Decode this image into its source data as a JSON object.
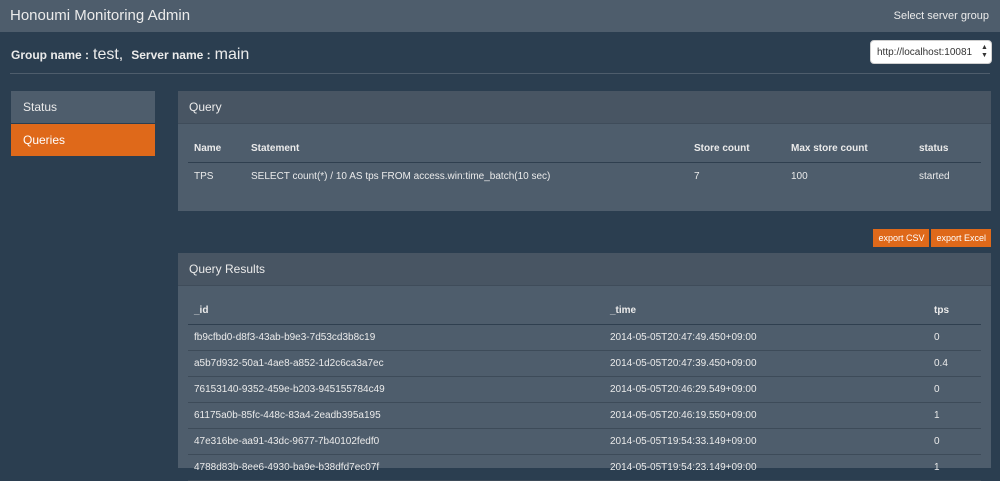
{
  "navbar": {
    "brand": "Honoumi Monitoring Admin",
    "right_link": "Select server group"
  },
  "header": {
    "group_label": "Group name :",
    "group_value": "test,",
    "server_label": "Server name :",
    "server_value": "main",
    "server_select": {
      "selected": "http://localhost:10081"
    }
  },
  "sidebar": {
    "items": [
      {
        "label": "Status"
      },
      {
        "label": "Queries"
      }
    ],
    "active_index": 1
  },
  "query_panel": {
    "title": "Query",
    "columns": [
      "Name",
      "Statement",
      "Store count",
      "Max store count",
      "status"
    ],
    "rows": [
      {
        "name": "TPS",
        "statement": "SELECT count(*) / 10 AS tps FROM access.win:time_batch(10 sec)",
        "store_count": "7",
        "max_store_count": "100",
        "status": "started"
      }
    ]
  },
  "buttons": {
    "export_csv": "export CSV",
    "export_excel": "export Excel"
  },
  "results_panel": {
    "title": "Query Results",
    "columns": [
      "_id",
      "_time",
      "tps"
    ],
    "rows": [
      {
        "id": "fb9cfbd0-d8f3-43ab-b9e3-7d53cd3b8c19",
        "time": "2014-05-05T20:47:49.450+09:00",
        "tps": "0"
      },
      {
        "id": "a5b7d932-50a1-4ae8-a852-1d2c6ca3a7ec",
        "time": "2014-05-05T20:47:39.450+09:00",
        "tps": "0.4"
      },
      {
        "id": "76153140-9352-459e-b203-945155784c49",
        "time": "2014-05-05T20:46:29.549+09:00",
        "tps": "0"
      },
      {
        "id": "61175a0b-85fc-448c-83a4-2eadb395a195",
        "time": "2014-05-05T20:46:19.550+09:00",
        "tps": "1"
      },
      {
        "id": "47e316be-aa91-43dc-9677-7b40102fedf0",
        "time": "2014-05-05T19:54:33.149+09:00",
        "tps": "0"
      },
      {
        "id": "4788d83b-8ee6-4930-ba9e-b38dfd7ec07f",
        "time": "2014-05-05T19:54:23.149+09:00",
        "tps": "1"
      }
    ]
  },
  "colors": {
    "background": "#2b3e50",
    "panel": "#4e5d6c",
    "accent": "#df691a",
    "text": "#ebebeb"
  }
}
